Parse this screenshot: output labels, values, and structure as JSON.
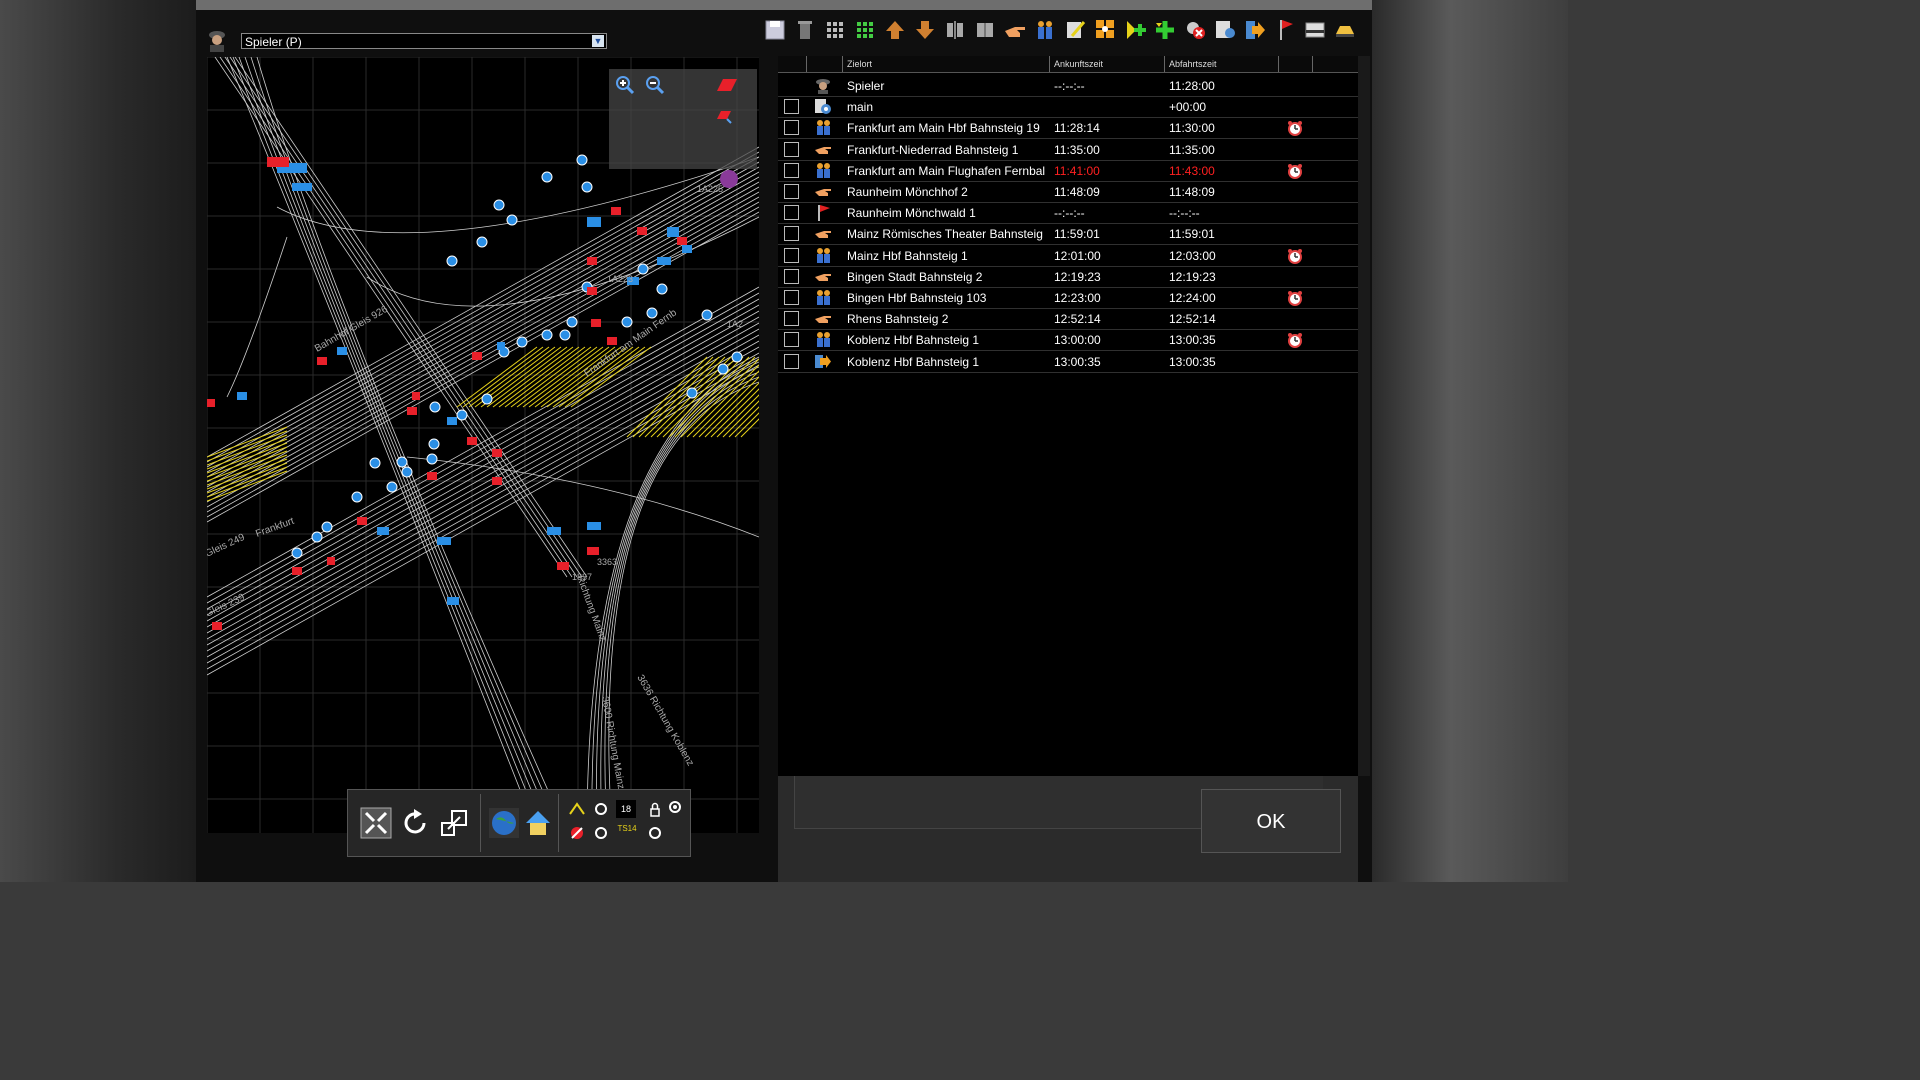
{
  "player": {
    "selected": "Spieler (P)"
  },
  "map": {
    "labels": [
      {
        "text": "Bahnhof Gleis 926",
        "cls": "lbl1"
      },
      {
        "text": "Frankfurt am Main Fernb",
        "cls": "lbl2"
      },
      {
        "text": "Frankfurt",
        "cls": "lbl3"
      },
      {
        "text": "Richtung Mainz",
        "cls": "lbl4"
      },
      {
        "text": "3600 Richtung Mainz",
        "cls": "lbl5"
      },
      {
        "text": "3636 Richtung Koblenz",
        "cls": "lbl6"
      },
      {
        "text": "Gleis 239",
        "cls": "lbl7"
      },
      {
        "text": "Gleis 249",
        "cls": "lbl8"
      }
    ],
    "signal_ids": [
      "1A225",
      "1A223",
      "1A2",
      "3363",
      "1837"
    ],
    "toolbar": {
      "counter": "18",
      "ts_label": "TS14"
    }
  },
  "schedule": {
    "columns": [
      "Zielort",
      "Ankunftszeit",
      "Abfahrtszeit"
    ],
    "rows": [
      {
        "icon": "driver-icon",
        "checkbox": false,
        "dest": "Spieler",
        "arr": "--:--:--",
        "dep": "11:28:00",
        "alarm": false,
        "red": false
      },
      {
        "icon": "script-gear-icon",
        "checkbox": true,
        "dest": "main",
        "arr": "",
        "dep": "+00:00",
        "alarm": false,
        "red": false
      },
      {
        "icon": "passenger-stop-icon",
        "checkbox": true,
        "dest": "Frankfurt am Main Hbf Bahnsteig 19",
        "arr": "11:28:14",
        "dep": "11:30:00",
        "alarm": true,
        "red": false
      },
      {
        "icon": "pointing-hand-icon",
        "checkbox": true,
        "dest": "Frankfurt-Niederrad Bahnsteig 1",
        "arr": "11:35:00",
        "dep": "11:35:00",
        "alarm": false,
        "red": false
      },
      {
        "icon": "passenger-stop-icon",
        "checkbox": true,
        "dest": "Frankfurt am Main Flughafen Fernbal",
        "arr": "11:41:00",
        "dep": "11:43:00",
        "alarm": true,
        "red": true
      },
      {
        "icon": "pointing-hand-icon",
        "checkbox": true,
        "dest": "Raunheim Mönchhof 2",
        "arr": "11:48:09",
        "dep": "11:48:09",
        "alarm": false,
        "red": false
      },
      {
        "icon": "flag-icon",
        "checkbox": true,
        "dest": "Raunheim Mönchwald 1",
        "arr": "--:--:--",
        "dep": "--:--:--",
        "alarm": false,
        "red": false
      },
      {
        "icon": "pointing-hand-icon",
        "checkbox": true,
        "dest": "Mainz Römisches Theater Bahnsteig",
        "arr": "11:59:01",
        "dep": "11:59:01",
        "alarm": false,
        "red": false
      },
      {
        "icon": "passenger-stop-icon",
        "checkbox": true,
        "dest": "Mainz Hbf Bahnsteig 1",
        "arr": "12:01:00",
        "dep": "12:03:00",
        "alarm": true,
        "red": false
      },
      {
        "icon": "pointing-hand-icon",
        "checkbox": true,
        "dest": "Bingen Stadt Bahnsteig 2",
        "arr": "12:19:23",
        "dep": "12:19:23",
        "alarm": false,
        "red": false
      },
      {
        "icon": "passenger-stop-icon",
        "checkbox": true,
        "dest": "Bingen Hbf Bahnsteig 103",
        "arr": "12:23:00",
        "dep": "12:24:00",
        "alarm": true,
        "red": false
      },
      {
        "icon": "pointing-hand-icon",
        "checkbox": true,
        "dest": "Rhens Bahnsteig 2",
        "arr": "12:52:14",
        "dep": "12:52:14",
        "alarm": false,
        "red": false
      },
      {
        "icon": "passenger-stop-icon",
        "checkbox": true,
        "dest": "Koblenz Hbf Bahnsteig 1",
        "arr": "13:00:00",
        "dep": "13:00:35",
        "alarm": true,
        "red": false
      },
      {
        "icon": "arrive-arrow-icon",
        "checkbox": true,
        "dest": "Koblenz Hbf Bahnsteig 1",
        "arr": "13:00:35",
        "dep": "13:00:35",
        "alarm": false,
        "red": false
      }
    ]
  },
  "ok_label": "OK",
  "colors": {
    "signal_blue": "#2a8fe6",
    "signal_red": "#e8202a",
    "platform_yellow": "#e6d21a",
    "track": "#cfcfcf"
  }
}
